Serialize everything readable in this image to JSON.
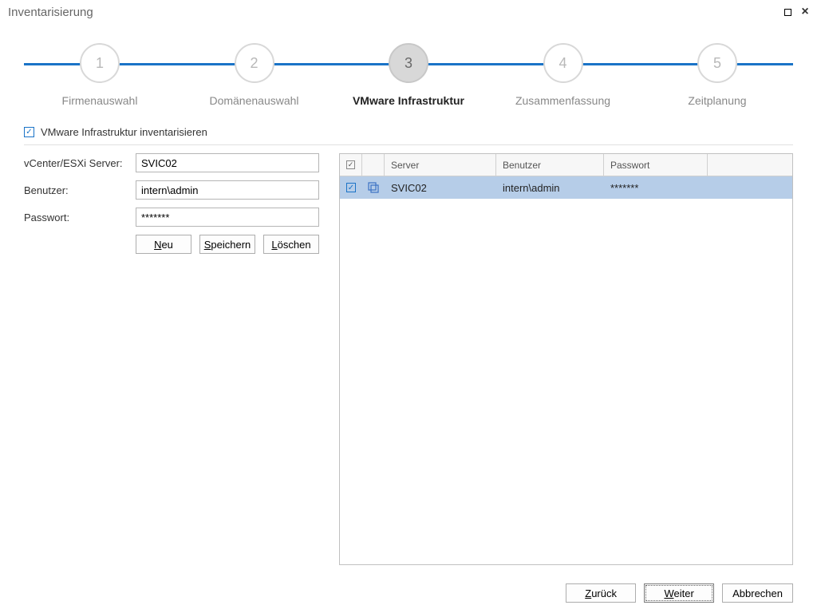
{
  "window": {
    "title": "Inventarisierung"
  },
  "stepper": {
    "steps": [
      {
        "num": "1",
        "label": "Firmenauswahl"
      },
      {
        "num": "2",
        "label": "Domänenauswahl"
      },
      {
        "num": "3",
        "label": "VMware Infrastruktur"
      },
      {
        "num": "4",
        "label": "Zusammenfassung"
      },
      {
        "num": "5",
        "label": "Zeitplanung"
      }
    ],
    "active_index": 2
  },
  "checkbox": {
    "label": "VMware Infrastruktur inventarisieren",
    "checked": true
  },
  "form": {
    "server_label": "vCenter/ESXi Server:",
    "server_value": "SVIC02",
    "user_label": "Benutzer:",
    "user_value": "intern\\admin",
    "pass_label": "Passwort:",
    "pass_value": "*******",
    "buttons": {
      "new": "Neu",
      "save": "Speichern",
      "delete": "Löschen"
    },
    "accel": {
      "new": "N",
      "save": "S",
      "delete": "L"
    }
  },
  "table": {
    "headers": {
      "server": "Server",
      "user": "Benutzer",
      "pass": "Passwort"
    },
    "rows": [
      {
        "checked": true,
        "server": "SVIC02",
        "user": "intern\\admin",
        "pass": "*******",
        "selected": true
      }
    ]
  },
  "footer": {
    "back": "Zurück",
    "next": "Weiter",
    "cancel": "Abbrechen",
    "accel": {
      "back": "Z",
      "next": "W"
    }
  }
}
